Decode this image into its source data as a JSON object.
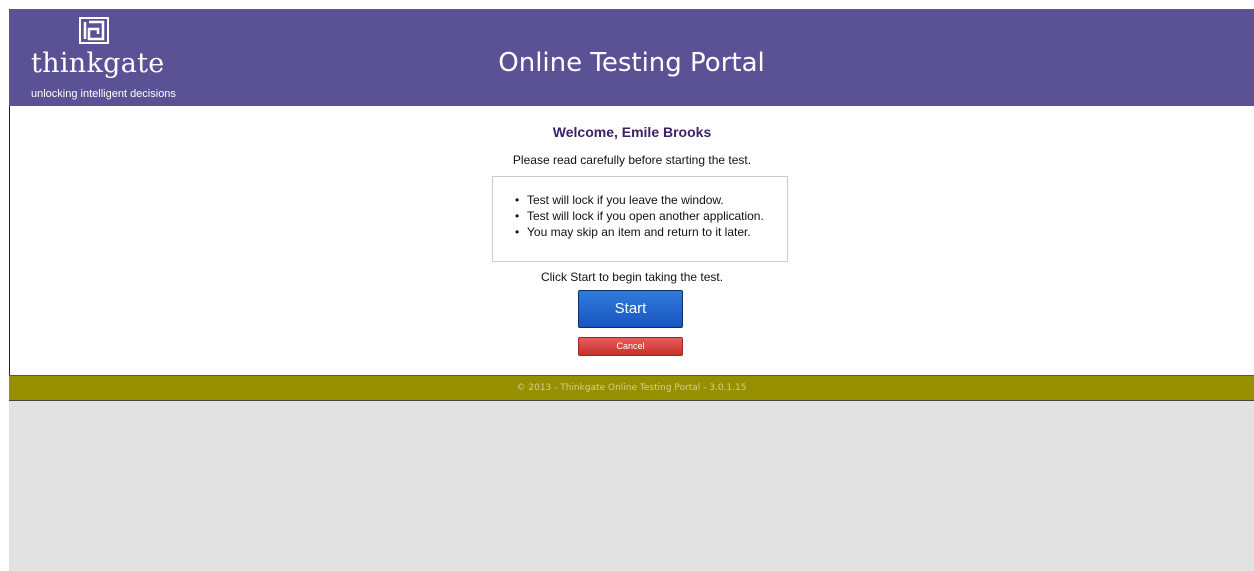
{
  "header": {
    "logo_wordmark": "thinkgate",
    "logo_tagline": "unlocking intelligent decisions",
    "title": "Online Testing Portal"
  },
  "main": {
    "welcome": "Welcome, Emile Brooks",
    "instructions": "Please read carefully before starting the test.",
    "notices": [
      "Test will lock if you leave the window.",
      "Test will lock if you open another application.",
      "You may skip an item and return to it later."
    ],
    "click_start": "Click Start to begin taking the test.",
    "start_label": "Start",
    "cancel_label": "Cancel"
  },
  "footer": {
    "text": "© 2013 - Thinkgate Online Testing Portal - 3.0.1.15"
  },
  "colors": {
    "header_bg": "#5a5295",
    "footer_bg": "#968f00",
    "start_button": "#1a55c1",
    "cancel_button": "#c8302c",
    "welcome_text": "#3b2168"
  }
}
